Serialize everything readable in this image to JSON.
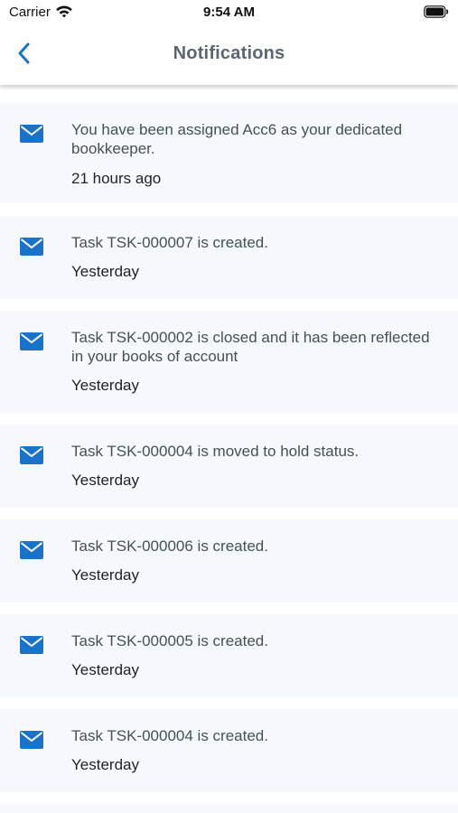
{
  "status_bar": {
    "carrier": "Carrier",
    "time": "9:54 AM"
  },
  "navbar": {
    "title": "Notifications",
    "back_icon": "chevron-left-icon"
  },
  "colors": {
    "accent": "#1a73c9",
    "card_bg": "#f5f8fc",
    "title": "#5b6670"
  },
  "notifications": [
    {
      "message": "You have been assigned Acc6 as your dedicated bookkeeper.",
      "time": "21 hours ago",
      "icon": "mail-icon"
    },
    {
      "message": "Task TSK-000007 is created.",
      "time": "Yesterday",
      "icon": "mail-icon"
    },
    {
      "message": "Task TSK-000002 is closed and it has been reflected in your books of account",
      "time": "Yesterday",
      "icon": "mail-icon"
    },
    {
      "message": "Task TSK-000004 is moved to hold status.",
      "time": "Yesterday",
      "icon": "mail-icon"
    },
    {
      "message": "Task TSK-000006 is created.",
      "time": "Yesterday",
      "icon": "mail-icon"
    },
    {
      "message": "Task TSK-000005 is created.",
      "time": "Yesterday",
      "icon": "mail-icon"
    },
    {
      "message": "Task TSK-000004 is created.",
      "time": "Yesterday",
      "icon": "mail-icon"
    }
  ]
}
